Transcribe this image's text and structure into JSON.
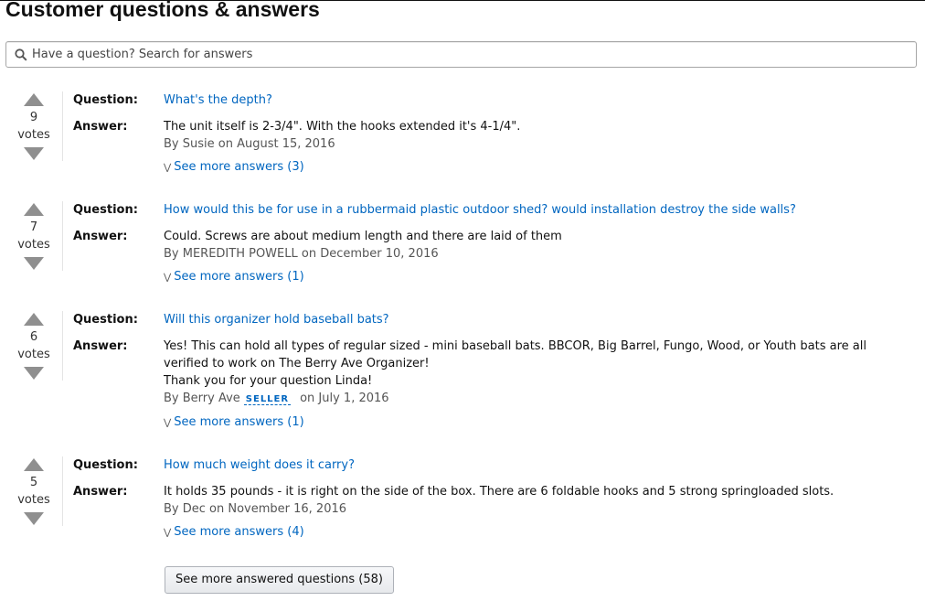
{
  "title": "Customer questions & answers",
  "search": {
    "placeholder": "Have a question? Search for answers"
  },
  "labels": {
    "question": "Question:",
    "answer": "Answer:",
    "votes": "votes"
  },
  "items": [
    {
      "votes": "9",
      "question": "What's the depth?",
      "answer_lines": [
        "The unit itself is 2-3/4\". With the hooks extended it's 4-1/4\"."
      ],
      "by_prefix": "By Susie",
      "by_date": " on August 15, 2016",
      "see_more": "See more answers (3)"
    },
    {
      "votes": "7",
      "question": "How would this be for use in a rubbermaid plastic outdoor shed? would installation destroy the side walls?",
      "answer_lines": [
        "Could. Screws are about medium length and there are laid of them"
      ],
      "by_prefix": "By MEREDITH POWELL",
      "by_date": " on December 10, 2016",
      "see_more": "See more answers (1)"
    },
    {
      "votes": "6",
      "question": "Will this organizer hold baseball bats?",
      "answer_lines": [
        "Yes! This can hold all types of regular sized - mini baseball bats. BBCOR, Big Barrel, Fungo, Wood, or Youth bats are all",
        "verified to work on The Berry Ave Organizer!",
        "Thank you for your question Linda!"
      ],
      "by_prefix": "By Berry Ave",
      "seller_badge": "SELLER",
      "by_date": "on July 1, 2016",
      "see_more": "See more answers (1)"
    },
    {
      "votes": "5",
      "question": "How much weight does it carry?",
      "answer_lines": [
        "It holds 35 pounds - it is right on the side of the box. There are 6 foldable hooks and 5 strong springloaded slots."
      ],
      "by_prefix": "By Dec",
      "by_date": " on November 16, 2016",
      "see_more": "See more answers (4)"
    }
  ],
  "more_questions_button": "See more answered questions (58)",
  "colors": {
    "link": "#0066c0",
    "vote_arrow": "#8f8f8f",
    "muted": "#555555"
  },
  "icons": {
    "search": "search-icon",
    "vote_up": "upvote-triangle-icon",
    "vote_down": "downvote-triangle-icon",
    "expand": "chevron-down-icon"
  }
}
